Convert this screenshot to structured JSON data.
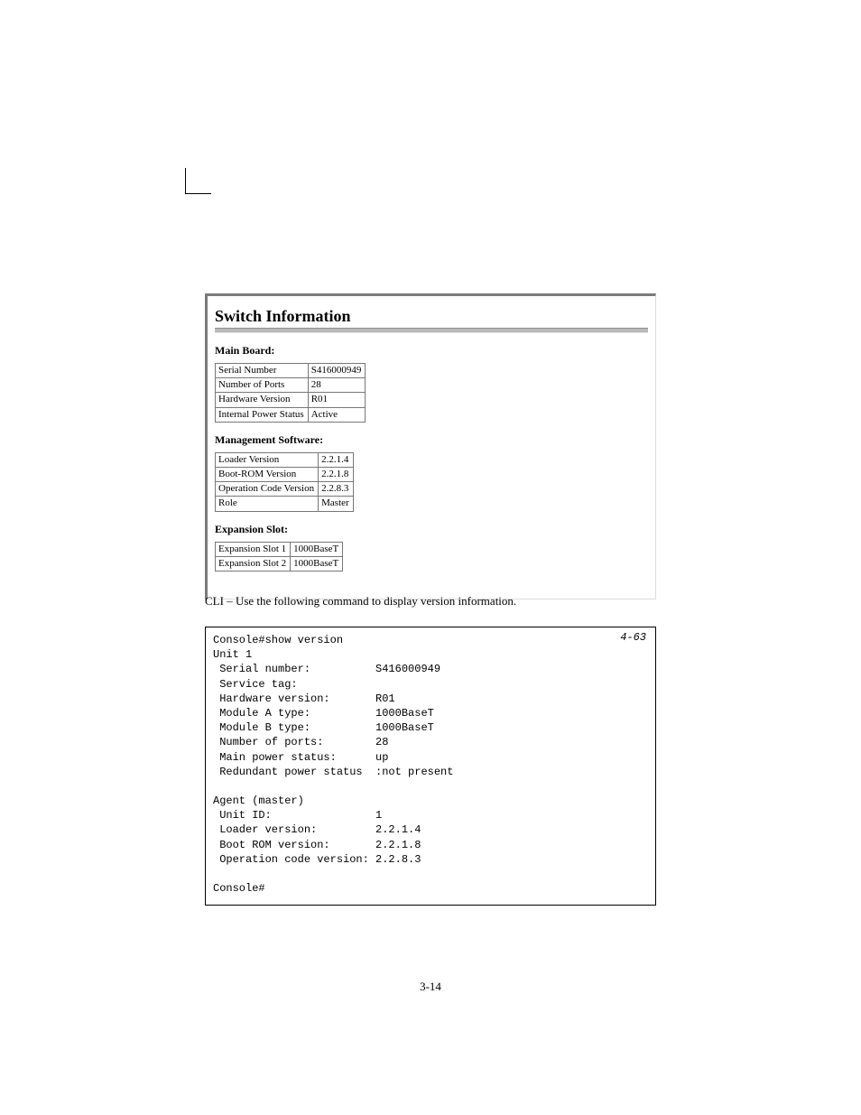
{
  "panel": {
    "title": "Switch Information",
    "sections": {
      "mainBoard": {
        "heading": "Main Board:",
        "rows": [
          {
            "label": "Serial Number",
            "value": "S416000949"
          },
          {
            "label": "Number of Ports",
            "value": "28"
          },
          {
            "label": "Hardware Version",
            "value": "R01"
          },
          {
            "label": "Internal Power Status",
            "value": "Active"
          }
        ]
      },
      "mgmtSoftware": {
        "heading": "Management Software:",
        "rows": [
          {
            "label": "Loader Version",
            "value": "2.2.1.4"
          },
          {
            "label": "Boot-ROM Version",
            "value": "2.2.1.8"
          },
          {
            "label": "Operation Code Version",
            "value": "2.2.8.3"
          },
          {
            "label": "Role",
            "value": "Master"
          }
        ]
      },
      "expansionSlot": {
        "heading": "Expansion Slot:",
        "rows": [
          {
            "label": "Expansion Slot 1",
            "value": "1000BaseT"
          },
          {
            "label": "Expansion Slot 2",
            "value": "1000BaseT"
          }
        ]
      }
    }
  },
  "cli": {
    "intro": "CLI – Use the following command to display version information.",
    "ref": "4-63",
    "text": "Console#show version\nUnit 1\n Serial number:          S416000949\n Service tag:\n Hardware version:       R01\n Module A type:          1000BaseT\n Module B type:          1000BaseT\n Number of ports:        28\n Main power status:      up\n Redundant power status  :not present\n\nAgent (master)\n Unit ID:                1\n Loader version:         2.2.1.4\n Boot ROM version:       2.2.1.8\n Operation code version: 2.2.8.3\n\nConsole#"
  },
  "footer": "3-14"
}
